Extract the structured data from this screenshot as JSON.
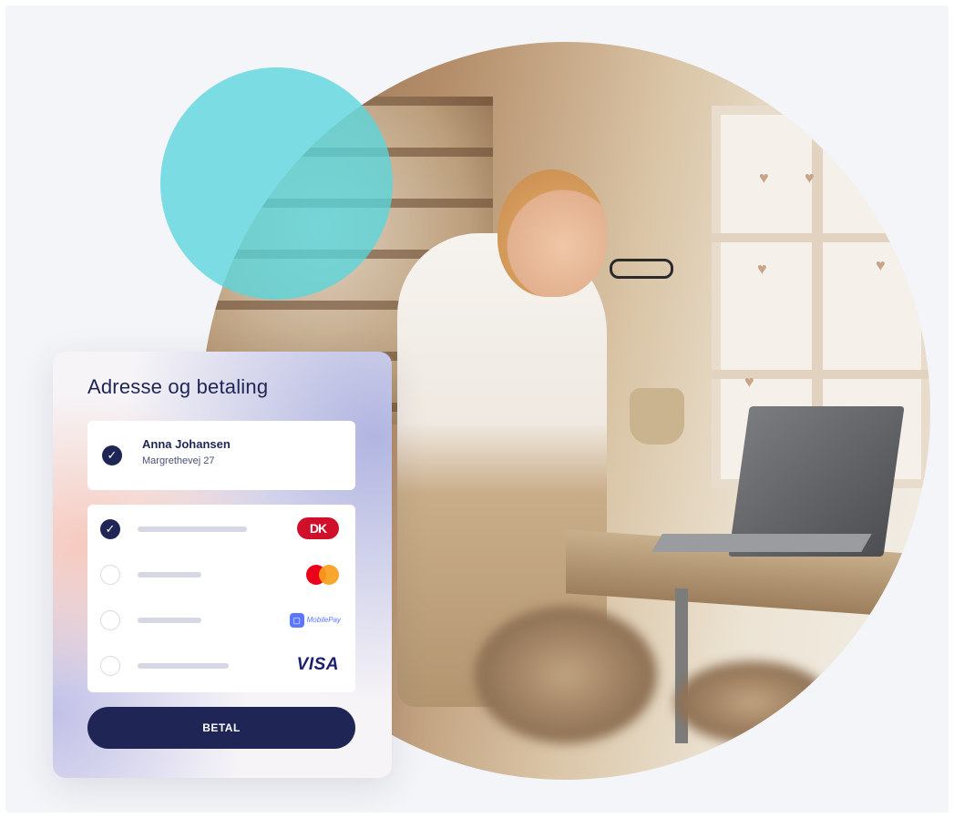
{
  "card": {
    "title": "Adresse og betaling",
    "address": {
      "name": "Anna Johansen",
      "street": "Margrethevej 27",
      "selected": true
    },
    "payment_methods": [
      {
        "id": "dankort",
        "logo_text": "DK",
        "selected": true
      },
      {
        "id": "mastercard",
        "selected": false
      },
      {
        "id": "mobilepay",
        "logo_text": "MobilePay",
        "selected": false
      },
      {
        "id": "visa",
        "logo_text": "VISA",
        "selected": false
      }
    ],
    "pay_button_label": "BETAL"
  },
  "icons": {
    "check": "✓",
    "heart": "♥"
  },
  "colors": {
    "navy": "#1f2554",
    "teal_circle": "#58d6dd",
    "dankort_red": "#d0102b",
    "mastercard_red": "#eb001b",
    "mastercard_orange": "#f79e1b",
    "mobilepay_blue": "#5a78ff",
    "visa_blue": "#1a1f71"
  }
}
